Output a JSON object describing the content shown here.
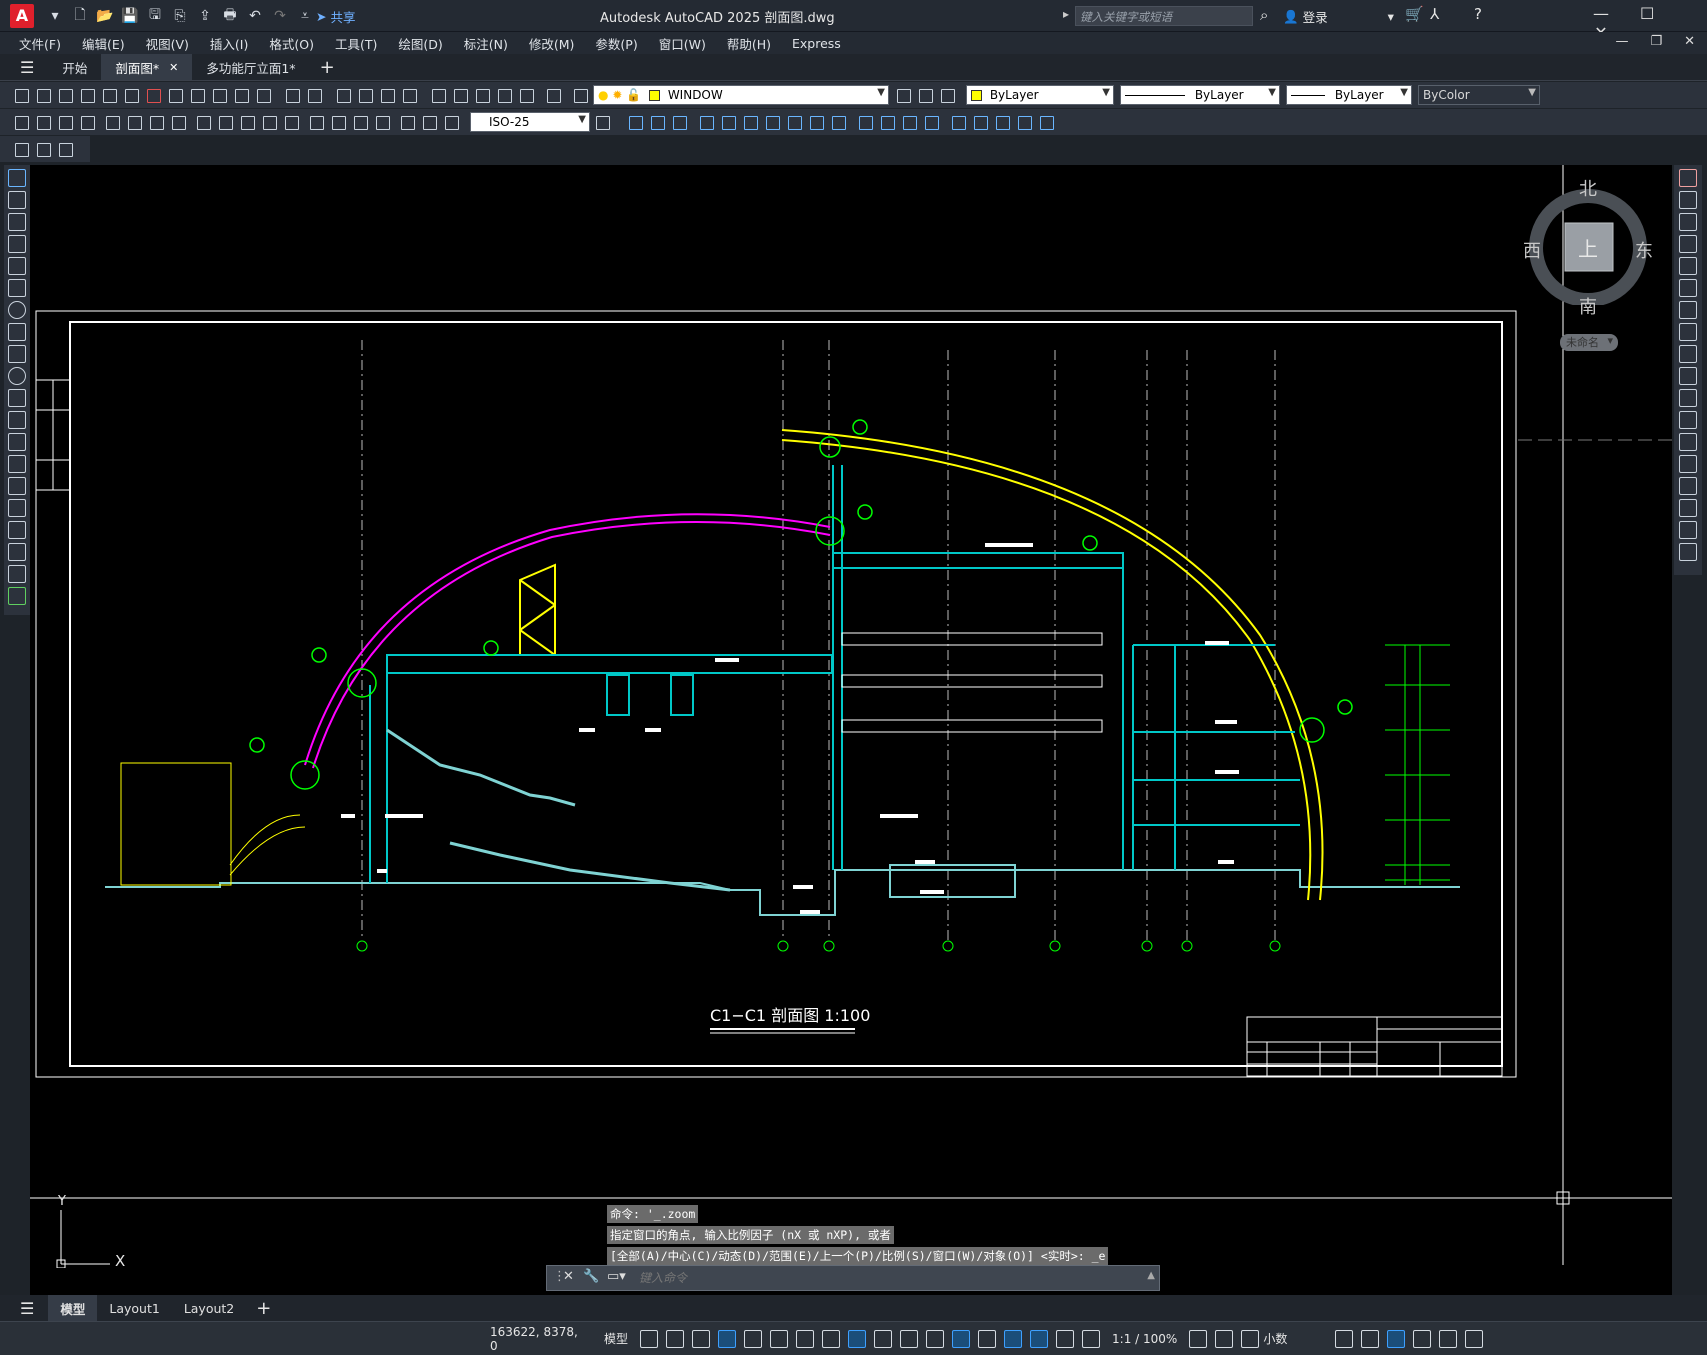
{
  "app": {
    "logo": "A",
    "title": "Autodesk AutoCAD 2025    剖面图.dwg",
    "share_label": "共享",
    "search_placeholder": "键入关键字或短语",
    "signin_label": "登录"
  },
  "menu": [
    "文件(F)",
    "编辑(E)",
    "视图(V)",
    "插入(I)",
    "格式(O)",
    "工具(T)",
    "绘图(D)",
    "标注(N)",
    "修改(M)",
    "参数(P)",
    "窗口(W)",
    "帮助(H)",
    "Express"
  ],
  "tabs": [
    {
      "label": "开始"
    },
    {
      "label": "剖面图*",
      "active": true
    },
    {
      "label": "多功能厅立面1*"
    }
  ],
  "toolbar": {
    "layer_name": "WINDOW",
    "color": "ByLayer",
    "linetype": "ByLayer",
    "lineweight": "ByLayer",
    "plotstyle": "ByColor",
    "dimstyle": "ISO-25"
  },
  "viewcube": {
    "north": "北",
    "south": "南",
    "east": "东",
    "west": "西",
    "face": "上",
    "ucs_label": "未命名"
  },
  "drawing": {
    "title": "C1−C1 剖面图    1:100",
    "colors": {
      "magenta_arc": "#ff00ff",
      "yellow_arc": "#ffff00",
      "structure": "#00c8c8",
      "annotation": "#00ff00",
      "walls": "#7fd3d3",
      "white": "#ffffff"
    }
  },
  "ucs": {
    "x": "X",
    "y": "Y"
  },
  "command": {
    "history": [
      "命令: '_.zoom",
      "指定窗口的角点, 输入比例因子 (nX 或 nXP), 或者",
      "[全部(A)/中心(C)/动态(D)/范围(E)/上一个(P)/比例(S)/窗口(W)/对象(O)] <实时>: _e"
    ],
    "placeholder": "键入命令"
  },
  "layout_tabs": [
    {
      "label": "模型",
      "active": true
    },
    {
      "label": "Layout1"
    },
    {
      "label": "Layout2"
    }
  ],
  "status": {
    "coords": "163622, 8378, 0",
    "model": "模型",
    "scale": "1:1 / 100%",
    "units": "小数"
  }
}
